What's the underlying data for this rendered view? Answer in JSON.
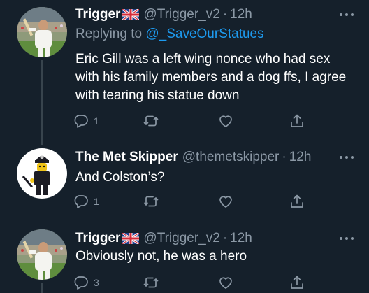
{
  "tweets": [
    {
      "name": "Trigger",
      "handle": "@Trigger_v2",
      "separator": "·",
      "time": "12h",
      "replying_prefix": "Replying to ",
      "replying_to": "@_SaveOurStatues",
      "text": "Eric Gill was a left wing nonce who had sex with his family members and a dog ffs, I agree with tearing his statue down",
      "reply_count": "1",
      "retweet_count": "",
      "like_count": ""
    },
    {
      "name": "The Met Skipper",
      "handle": "@themetskipper",
      "separator": "·",
      "time": "12h",
      "text": "And Colston’s?",
      "reply_count": "1",
      "retweet_count": "",
      "like_count": ""
    },
    {
      "name": "Trigger",
      "handle": "@Trigger_v2",
      "separator": "·",
      "time": "12h",
      "text": "Obviously not, he was a hero",
      "reply_count": "3",
      "retweet_count": "",
      "like_count": ""
    }
  ],
  "icons": {
    "reply": "reply-icon",
    "retweet": "retweet-icon",
    "like": "like-icon",
    "share": "share-icon",
    "more": "more-icon",
    "flag": "uk-flag-icon"
  },
  "colors": {
    "background": "#15202b",
    "text": "#ffffff",
    "secondary": "#8b98a5",
    "link": "#1d9bf0",
    "thread_line": "#38444d"
  }
}
